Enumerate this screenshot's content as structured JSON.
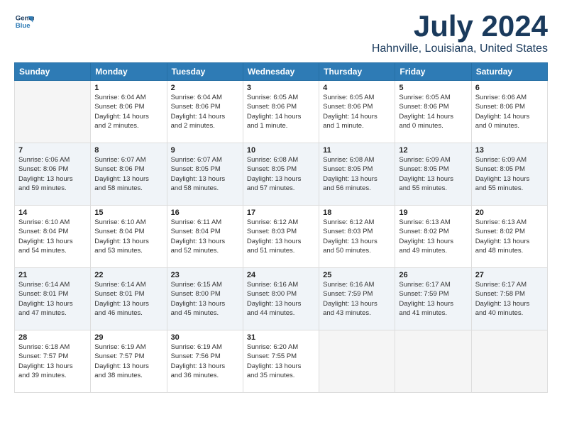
{
  "logo": {
    "line1": "General",
    "line2": "Blue"
  },
  "title": "July 2024",
  "location": "Hahnville, Louisiana, United States",
  "weekdays": [
    "Sunday",
    "Monday",
    "Tuesday",
    "Wednesday",
    "Thursday",
    "Friday",
    "Saturday"
  ],
  "weeks": [
    [
      {
        "day": "",
        "info": ""
      },
      {
        "day": "1",
        "info": "Sunrise: 6:04 AM\nSunset: 8:06 PM\nDaylight: 14 hours\nand 2 minutes."
      },
      {
        "day": "2",
        "info": "Sunrise: 6:04 AM\nSunset: 8:06 PM\nDaylight: 14 hours\nand 2 minutes."
      },
      {
        "day": "3",
        "info": "Sunrise: 6:05 AM\nSunset: 8:06 PM\nDaylight: 14 hours\nand 1 minute."
      },
      {
        "day": "4",
        "info": "Sunrise: 6:05 AM\nSunset: 8:06 PM\nDaylight: 14 hours\nand 1 minute."
      },
      {
        "day": "5",
        "info": "Sunrise: 6:05 AM\nSunset: 8:06 PM\nDaylight: 14 hours\nand 0 minutes."
      },
      {
        "day": "6",
        "info": "Sunrise: 6:06 AM\nSunset: 8:06 PM\nDaylight: 14 hours\nand 0 minutes."
      }
    ],
    [
      {
        "day": "7",
        "info": "Sunrise: 6:06 AM\nSunset: 8:06 PM\nDaylight: 13 hours\nand 59 minutes."
      },
      {
        "day": "8",
        "info": "Sunrise: 6:07 AM\nSunset: 8:06 PM\nDaylight: 13 hours\nand 58 minutes."
      },
      {
        "day": "9",
        "info": "Sunrise: 6:07 AM\nSunset: 8:05 PM\nDaylight: 13 hours\nand 58 minutes."
      },
      {
        "day": "10",
        "info": "Sunrise: 6:08 AM\nSunset: 8:05 PM\nDaylight: 13 hours\nand 57 minutes."
      },
      {
        "day": "11",
        "info": "Sunrise: 6:08 AM\nSunset: 8:05 PM\nDaylight: 13 hours\nand 56 minutes."
      },
      {
        "day": "12",
        "info": "Sunrise: 6:09 AM\nSunset: 8:05 PM\nDaylight: 13 hours\nand 55 minutes."
      },
      {
        "day": "13",
        "info": "Sunrise: 6:09 AM\nSunset: 8:05 PM\nDaylight: 13 hours\nand 55 minutes."
      }
    ],
    [
      {
        "day": "14",
        "info": "Sunrise: 6:10 AM\nSunset: 8:04 PM\nDaylight: 13 hours\nand 54 minutes."
      },
      {
        "day": "15",
        "info": "Sunrise: 6:10 AM\nSunset: 8:04 PM\nDaylight: 13 hours\nand 53 minutes."
      },
      {
        "day": "16",
        "info": "Sunrise: 6:11 AM\nSunset: 8:04 PM\nDaylight: 13 hours\nand 52 minutes."
      },
      {
        "day": "17",
        "info": "Sunrise: 6:12 AM\nSunset: 8:03 PM\nDaylight: 13 hours\nand 51 minutes."
      },
      {
        "day": "18",
        "info": "Sunrise: 6:12 AM\nSunset: 8:03 PM\nDaylight: 13 hours\nand 50 minutes."
      },
      {
        "day": "19",
        "info": "Sunrise: 6:13 AM\nSunset: 8:02 PM\nDaylight: 13 hours\nand 49 minutes."
      },
      {
        "day": "20",
        "info": "Sunrise: 6:13 AM\nSunset: 8:02 PM\nDaylight: 13 hours\nand 48 minutes."
      }
    ],
    [
      {
        "day": "21",
        "info": "Sunrise: 6:14 AM\nSunset: 8:01 PM\nDaylight: 13 hours\nand 47 minutes."
      },
      {
        "day": "22",
        "info": "Sunrise: 6:14 AM\nSunset: 8:01 PM\nDaylight: 13 hours\nand 46 minutes."
      },
      {
        "day": "23",
        "info": "Sunrise: 6:15 AM\nSunset: 8:00 PM\nDaylight: 13 hours\nand 45 minutes."
      },
      {
        "day": "24",
        "info": "Sunrise: 6:16 AM\nSunset: 8:00 PM\nDaylight: 13 hours\nand 44 minutes."
      },
      {
        "day": "25",
        "info": "Sunrise: 6:16 AM\nSunset: 7:59 PM\nDaylight: 13 hours\nand 43 minutes."
      },
      {
        "day": "26",
        "info": "Sunrise: 6:17 AM\nSunset: 7:59 PM\nDaylight: 13 hours\nand 41 minutes."
      },
      {
        "day": "27",
        "info": "Sunrise: 6:17 AM\nSunset: 7:58 PM\nDaylight: 13 hours\nand 40 minutes."
      }
    ],
    [
      {
        "day": "28",
        "info": "Sunrise: 6:18 AM\nSunset: 7:57 PM\nDaylight: 13 hours\nand 39 minutes."
      },
      {
        "day": "29",
        "info": "Sunrise: 6:19 AM\nSunset: 7:57 PM\nDaylight: 13 hours\nand 38 minutes."
      },
      {
        "day": "30",
        "info": "Sunrise: 6:19 AM\nSunset: 7:56 PM\nDaylight: 13 hours\nand 36 minutes."
      },
      {
        "day": "31",
        "info": "Sunrise: 6:20 AM\nSunset: 7:55 PM\nDaylight: 13 hours\nand 35 minutes."
      },
      {
        "day": "",
        "info": ""
      },
      {
        "day": "",
        "info": ""
      },
      {
        "day": "",
        "info": ""
      }
    ]
  ]
}
